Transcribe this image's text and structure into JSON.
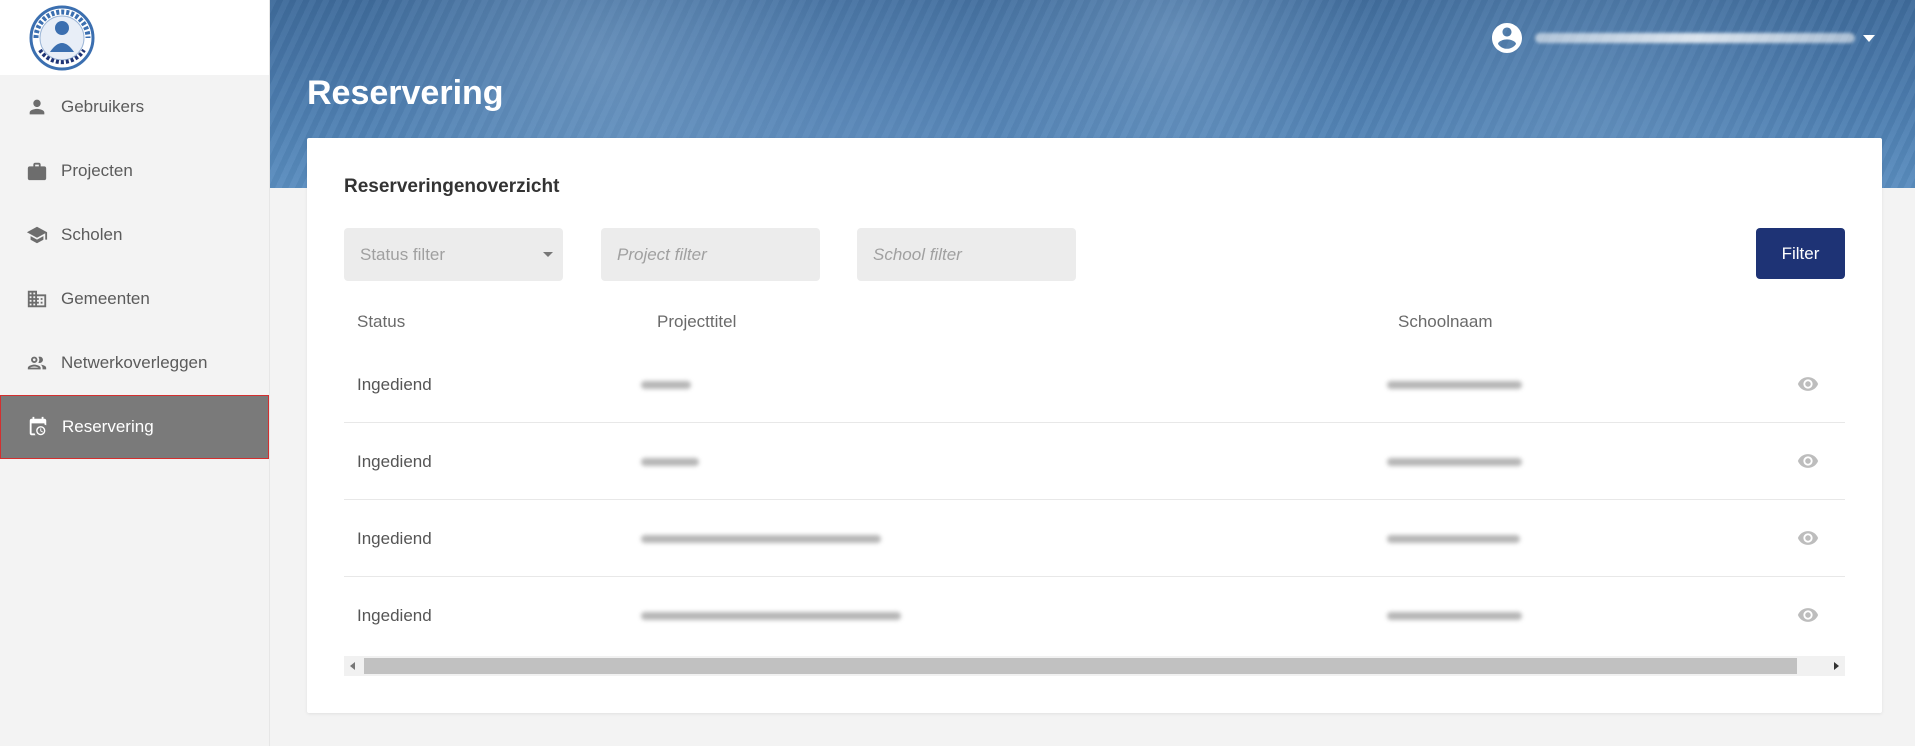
{
  "app": {
    "logo_text": "VERWEERSACTIEVE SCHOOL"
  },
  "sidebar": {
    "items": [
      {
        "label": "Gebruikers",
        "icon": "person-icon",
        "active": false
      },
      {
        "label": "Projecten",
        "icon": "briefcase-icon",
        "active": false
      },
      {
        "label": "Scholen",
        "icon": "school-icon",
        "active": false
      },
      {
        "label": "Gemeenten",
        "icon": "building-icon",
        "active": false
      },
      {
        "label": "Netwerkoverleggen",
        "icon": "people-icon",
        "active": false
      },
      {
        "label": "Reservering",
        "icon": "calendar-clock-icon",
        "active": true
      }
    ]
  },
  "header": {
    "title": "Reservering",
    "user_icon": "account-circle-icon",
    "user_menu_icon": "caret-down-icon"
  },
  "card": {
    "title": "Reserveringenoverzicht",
    "filters": {
      "status_placeholder": "Status filter",
      "project_placeholder": "Project filter",
      "school_placeholder": "School filter",
      "button_label": "Filter"
    },
    "table": {
      "columns": [
        "Status",
        "Projecttitel",
        "Schoolnaam"
      ],
      "rows": [
        {
          "status": "Ingediend",
          "action_icon": "eye-icon"
        },
        {
          "status": "Ingediend",
          "action_icon": "eye-icon"
        },
        {
          "status": "Ingediend",
          "action_icon": "eye-icon"
        },
        {
          "status": "Ingediend",
          "action_icon": "eye-icon"
        }
      ]
    }
  },
  "colors": {
    "accent": "#1e3375",
    "active_nav_bg": "#7a7a7a",
    "active_nav_border": "#d32f2f",
    "banner": "#4d7eb0"
  }
}
